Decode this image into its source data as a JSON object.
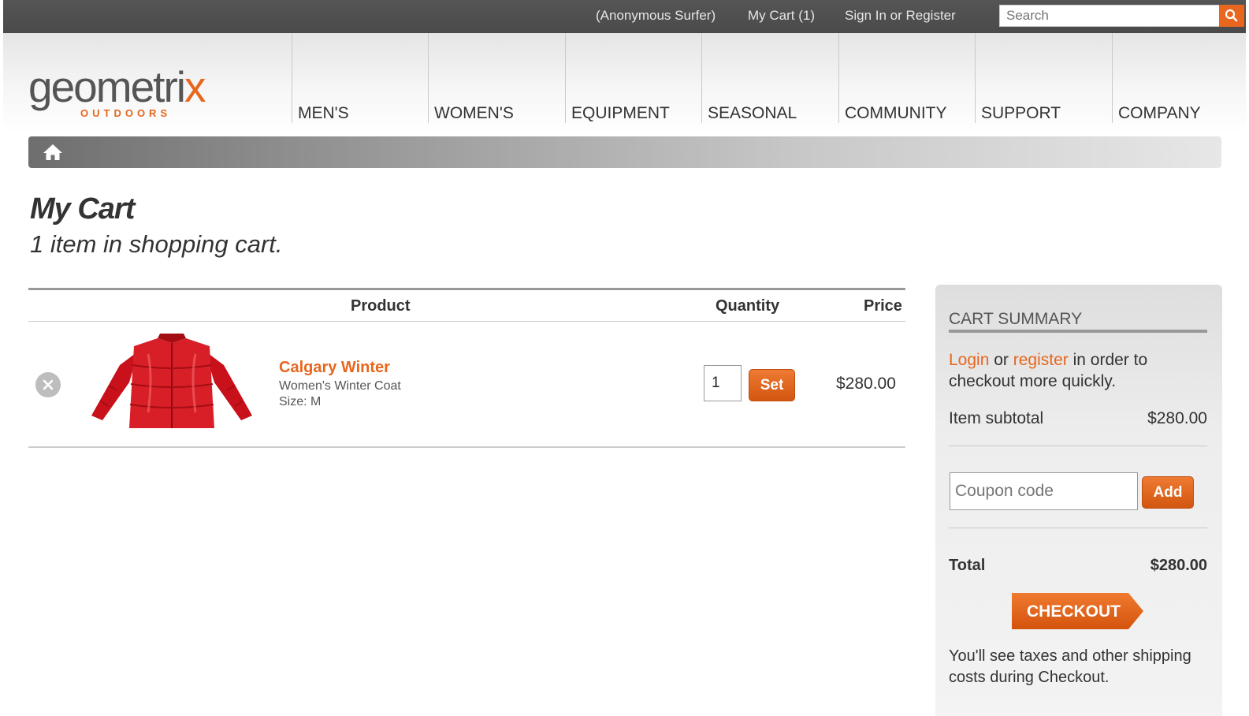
{
  "topbar": {
    "user": "(Anonymous Surfer)",
    "cart": "My Cart (1)",
    "signin": "Sign In or Register",
    "search_placeholder": "Search",
    "search_icon": "search-icon"
  },
  "logo": {
    "main": "geometri",
    "x": "x",
    "sub": "OUTDOORS"
  },
  "nav": {
    "items": [
      "MEN'S",
      "WOMEN'S",
      "EQUIPMENT",
      "SEASONAL",
      "COMMUNITY",
      "SUPPORT",
      "COMPANY"
    ]
  },
  "breadcrumb": {
    "icon": "home-icon"
  },
  "page": {
    "title": "My Cart",
    "subtitle": "1 item in shopping cart."
  },
  "cart": {
    "headers": {
      "product": "Product",
      "quantity": "Quantity",
      "price": "Price"
    },
    "items": [
      {
        "name": "Calgary Winter",
        "description": "Women's Winter Coat",
        "size": "Size: M",
        "quantity": "1",
        "set_label": "Set",
        "price": "$280.00",
        "image_icon": "red-jacket-image"
      }
    ]
  },
  "summary": {
    "title": "CART SUMMARY",
    "login_link": "Login",
    "or_text": " or ",
    "register_link": "register",
    "login_suffix": " in order to checkout more quickly.",
    "subtotal_label": "Item subtotal",
    "subtotal_value": "$280.00",
    "coupon_placeholder": "Coupon code",
    "add_label": "Add",
    "total_label": "Total",
    "total_value": "$280.00",
    "checkout_label": "CHECKOUT",
    "note": "You'll see taxes and other shipping costs during Checkout."
  },
  "colors": {
    "accent": "#e8661d",
    "topbar": "#4d4d4d"
  }
}
